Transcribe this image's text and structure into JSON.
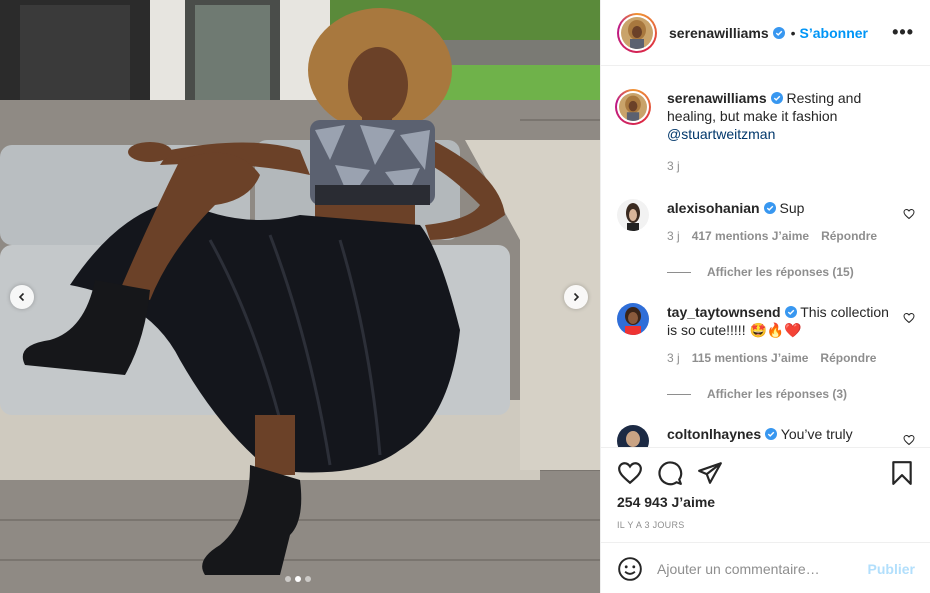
{
  "post": {
    "author": "serenawilliams",
    "follow_label": "S’abonner",
    "separator": "•",
    "more_label": "•••",
    "caption_text": "Resting and healing, but make it fashion",
    "caption_mention": "@stuartweitzman",
    "caption_time": "3 j"
  },
  "comments": [
    {
      "user": "alexisohanian",
      "text": "Sup",
      "time": "3 j",
      "likes": "417 mentions J’aime",
      "reply": "Répondre",
      "view_replies": "Afficher les réponses (15)"
    },
    {
      "user": "tay_taytownsend",
      "text": "This collection is so cute!!!!! 🤩🔥❤️",
      "time": "3 j",
      "likes": "115 mentions J’aime",
      "reply": "Répondre",
      "view_replies": "Afficher les réponses (3)"
    },
    {
      "user": "coltonlhaynes",
      "text": "You’ve truly"
    }
  ],
  "engagement": {
    "likes": "254 943 J’aime",
    "date": "IL Y A 3 JOURS"
  },
  "composer": {
    "placeholder": "Ajouter un commentaire…",
    "publish_label": "Publier"
  },
  "icons": {
    "like": "heart-icon",
    "comment": "comment-icon",
    "share": "paper-plane-icon",
    "save": "bookmark-icon",
    "emoji": "smiley-icon",
    "verified": "verified-badge-icon"
  },
  "colors": {
    "accent": "#0095f6",
    "verified": "#3897f0",
    "publish_disabled": "#b2dffc",
    "muted": "#8e8e8e"
  },
  "carousel": {
    "total": 3,
    "active": 2
  }
}
